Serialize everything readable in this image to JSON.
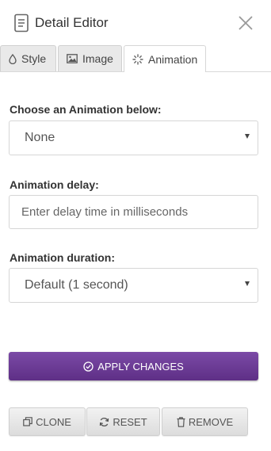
{
  "header": {
    "title": "Detail Editor",
    "icon": "document-icon",
    "close_icon": "close-icon"
  },
  "tabs": [
    {
      "label": "Style",
      "icon": "droplet-icon",
      "active": false
    },
    {
      "label": "Image",
      "icon": "image-icon",
      "active": false
    },
    {
      "label": "Animation",
      "icon": "spinner-icon",
      "active": true
    }
  ],
  "form": {
    "animation": {
      "label": "Choose an Animation below:",
      "value": "None"
    },
    "delay": {
      "label": "Animation delay:",
      "placeholder": "Enter delay time in milliseconds",
      "value": ""
    },
    "duration": {
      "label": "Animation duration:",
      "value": "Default (1 second)"
    }
  },
  "actions": {
    "apply": {
      "label": "APPLY CHANGES",
      "icon": "check-circle-icon"
    },
    "clone": {
      "label": "CLONE",
      "icon": "clone-icon"
    },
    "reset": {
      "label": "RESET",
      "icon": "refresh-icon"
    },
    "remove": {
      "label": "REMOVE",
      "icon": "trash-icon"
    }
  },
  "colors": {
    "accent": "#6a3b94",
    "tab_background": "#e9e9e9",
    "border": "#d6d6d6"
  }
}
